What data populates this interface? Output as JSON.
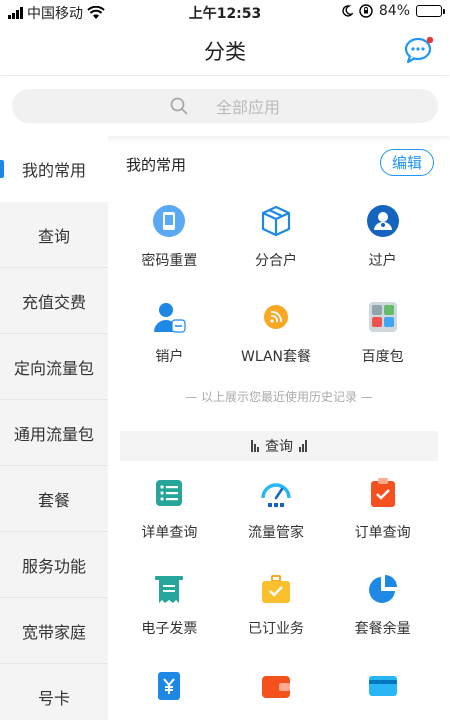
{
  "status_bar": {
    "carrier": "中国移动",
    "time": "上午12:53",
    "battery": "84%",
    "battery_level": 0.84
  },
  "header": {
    "title": "分类",
    "message_icon": "chat-bubble-icon",
    "accent": "#2196f3"
  },
  "search": {
    "placeholder": "全部应用",
    "icon": "search-icon"
  },
  "sidebar": {
    "items": [
      {
        "label": "我的常用",
        "active": true
      },
      {
        "label": "查询"
      },
      {
        "label": "充值交费"
      },
      {
        "label": "定向流量包"
      },
      {
        "label": "通用流量包"
      },
      {
        "label": "套餐"
      },
      {
        "label": "服务功能"
      },
      {
        "label": "宽带家庭"
      },
      {
        "label": "号卡"
      }
    ]
  },
  "main": {
    "section_title": "我的常用",
    "edit_label": "编辑",
    "favorites": [
      {
        "label": "密码重置",
        "icon": "phone-password-icon"
      },
      {
        "label": "分合户",
        "icon": "box-icon"
      },
      {
        "label": "过户",
        "icon": "user-transfer-icon"
      },
      {
        "label": "销户",
        "icon": "user-cancel-icon"
      },
      {
        "label": "WLAN套餐",
        "icon": "wifi-icon"
      },
      {
        "label": "百度包",
        "icon": "app-grid-icon"
      }
    ],
    "hint": "— 以上展示您最近使用历史记录 —",
    "query_section_label": "查询",
    "query_items": [
      {
        "label": "详单查询",
        "icon": "list-icon"
      },
      {
        "label": "流量管家",
        "icon": "speedometer-icon"
      },
      {
        "label": "订单查询",
        "icon": "clipboard-icon"
      },
      {
        "label": "电子发票",
        "icon": "invoice-icon"
      },
      {
        "label": "已订业务",
        "icon": "briefcase-icon"
      },
      {
        "label": "套餐余量",
        "icon": "pie-icon"
      },
      {
        "label": "",
        "icon": "yuan-icon"
      },
      {
        "label": "",
        "icon": "wallet-icon"
      },
      {
        "label": "",
        "icon": "card-icon"
      }
    ]
  }
}
